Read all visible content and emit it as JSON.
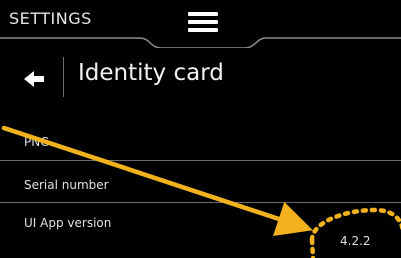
{
  "header": {
    "title": "SETTINGS"
  },
  "page": {
    "title": "Identity card"
  },
  "rows": [
    {
      "label": "PNC"
    },
    {
      "label": "Serial number"
    },
    {
      "label": "UI App version",
      "value": "4.2.2"
    }
  ],
  "colors": {
    "background": "#000000",
    "header_line": "#8a8a8a",
    "annotation": "#f2b21e"
  },
  "icons": {
    "menu": "hamburger-icon",
    "back": "arrow-left-icon"
  }
}
